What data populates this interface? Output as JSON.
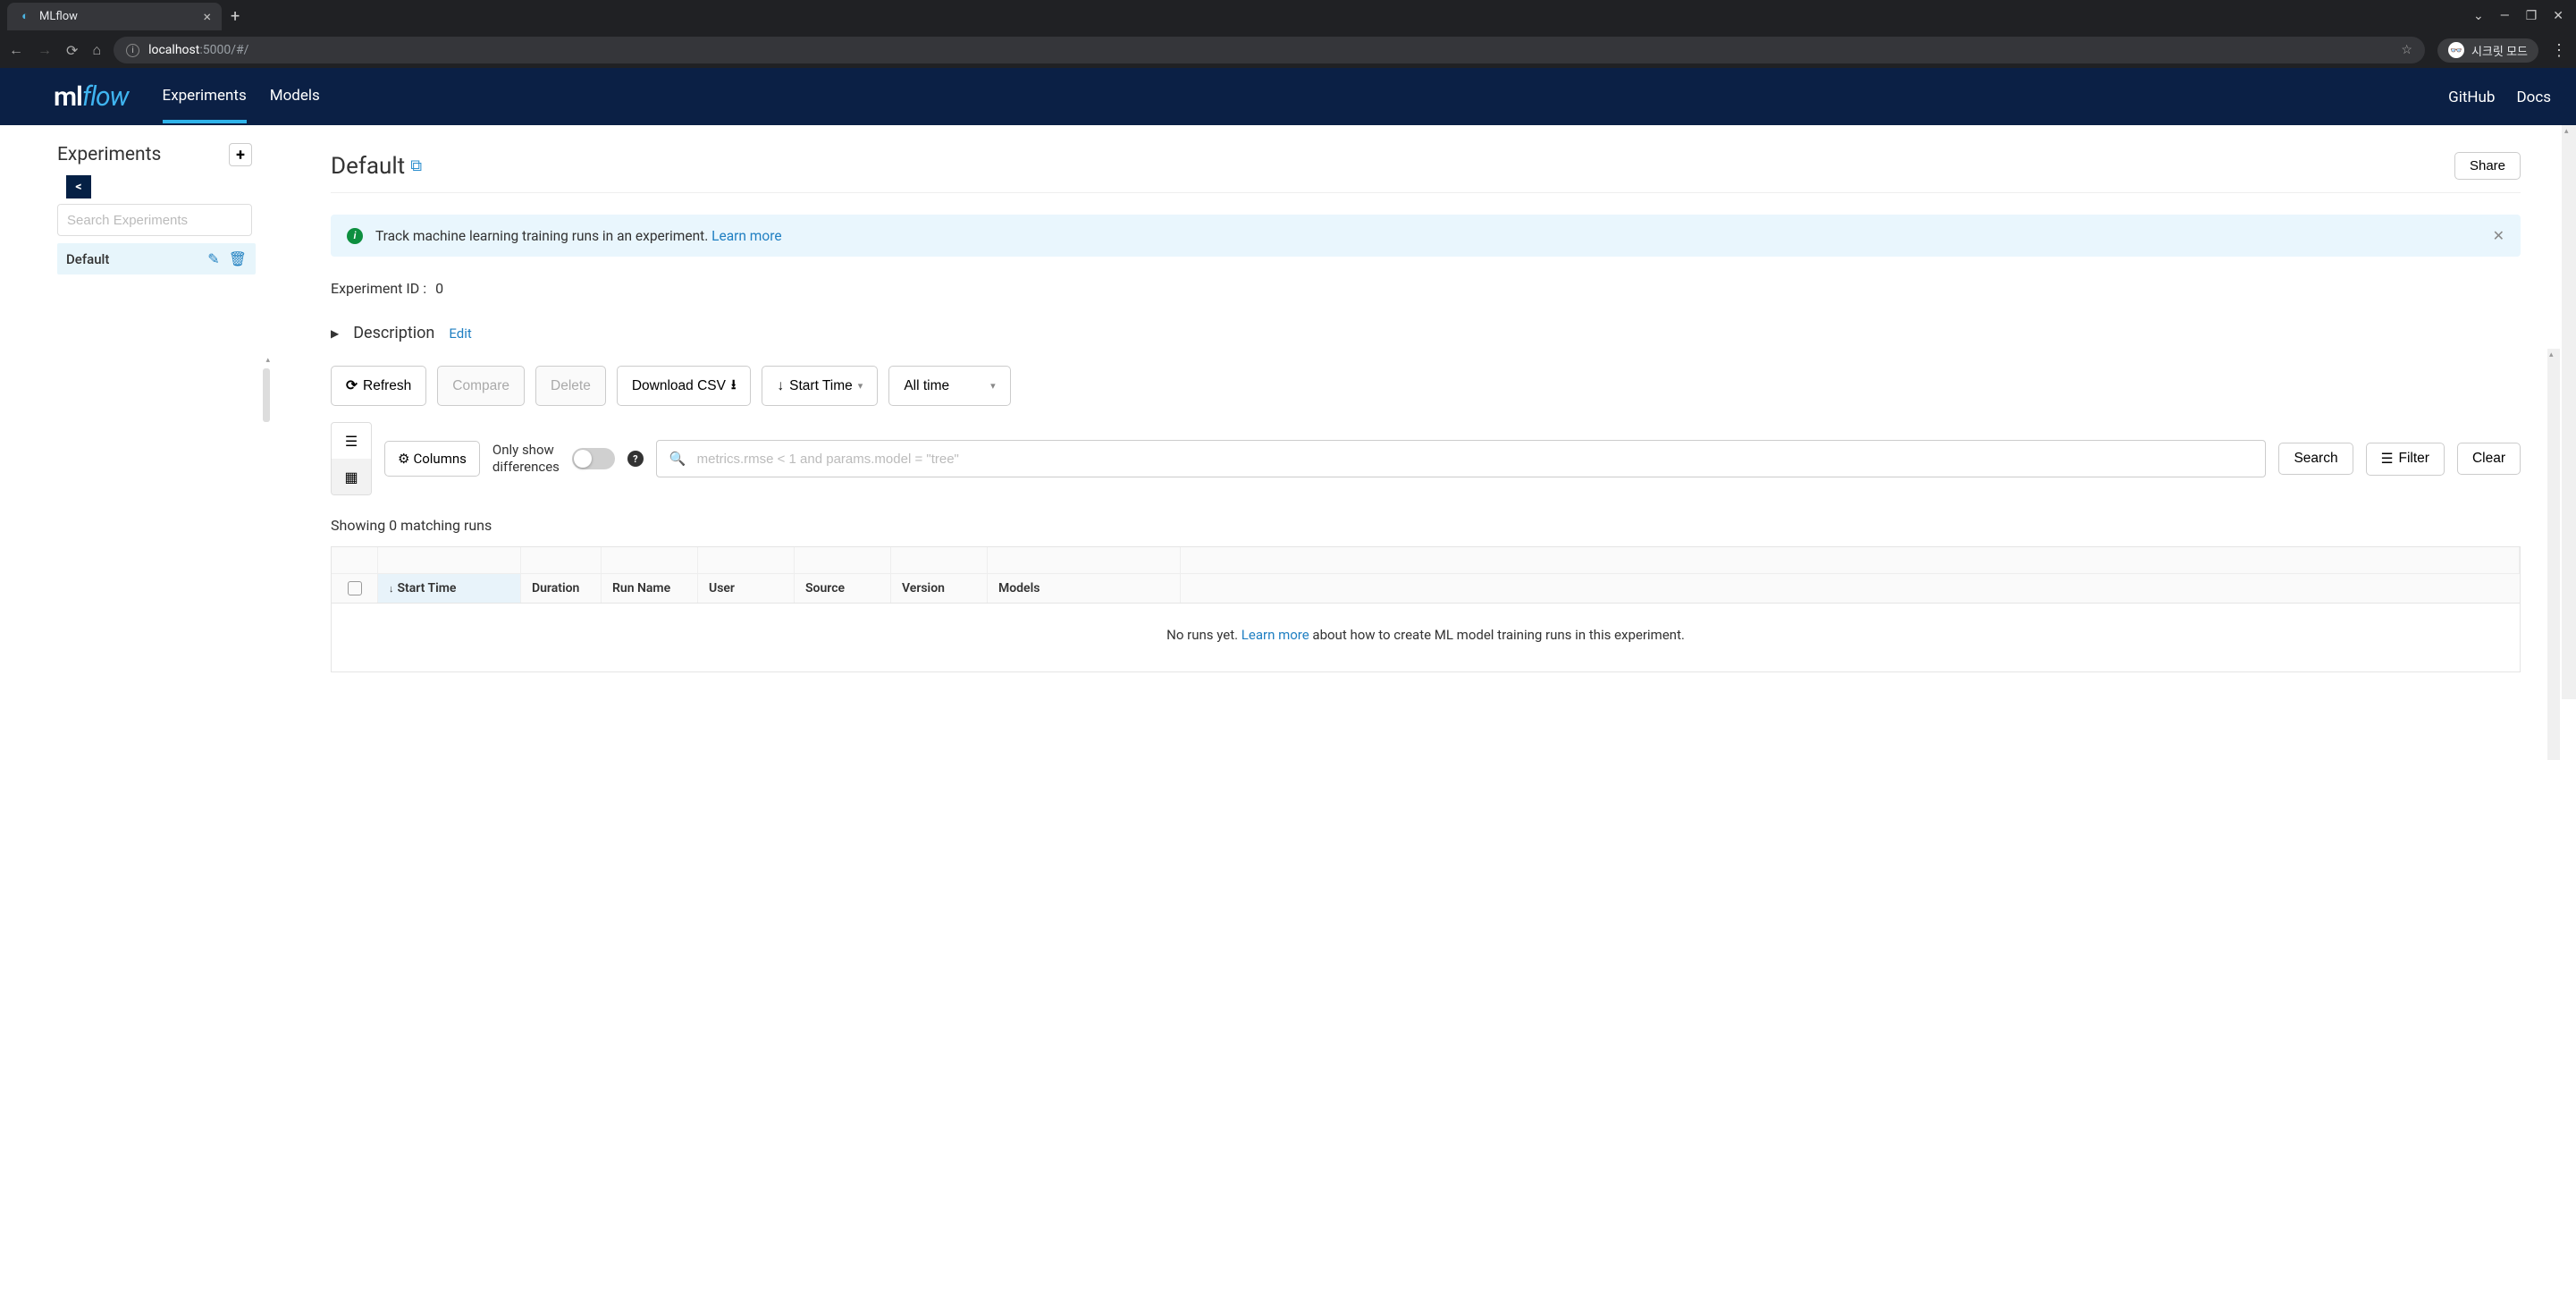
{
  "browser": {
    "tab_title": "MLflow",
    "url_host": "localhost",
    "url_port_path": ":5000/#/",
    "incognito_label": "시크릿 모드"
  },
  "header": {
    "logo_ml": "ml",
    "logo_flow": "flow",
    "nav_experiments": "Experiments",
    "nav_models": "Models",
    "nav_github": "GitHub",
    "nav_docs": "Docs"
  },
  "sidebar": {
    "title": "Experiments",
    "search_placeholder": "Search Experiments",
    "items": [
      {
        "name": "Default"
      }
    ]
  },
  "main": {
    "title": "Default",
    "share_label": "Share",
    "banner_text": "Track machine learning training runs in an experiment. ",
    "banner_link": "Learn more",
    "exp_id_label": "Experiment ID :",
    "exp_id_value": "0",
    "description_label": "Description",
    "edit_link": "Edit",
    "toolbar": {
      "refresh": "Refresh",
      "compare": "Compare",
      "delete": "Delete",
      "download": "Download CSV",
      "start_time": "Start Time",
      "time_filter": "All time",
      "columns": "Columns",
      "only_diff_l1": "Only show",
      "only_diff_l2": "differences",
      "search_placeholder": "metrics.rmse < 1 and params.model = \"tree\"",
      "search": "Search",
      "filter": "Filter",
      "clear": "Clear"
    },
    "status": "Showing 0 matching runs",
    "columns": {
      "start_time": "Start Time",
      "duration": "Duration",
      "run_name": "Run Name",
      "user": "User",
      "source": "Source",
      "version": "Version",
      "models": "Models"
    },
    "empty_pre": "No runs yet. ",
    "empty_link": "Learn more",
    "empty_post": " about how to create ML model training runs in this experiment."
  }
}
